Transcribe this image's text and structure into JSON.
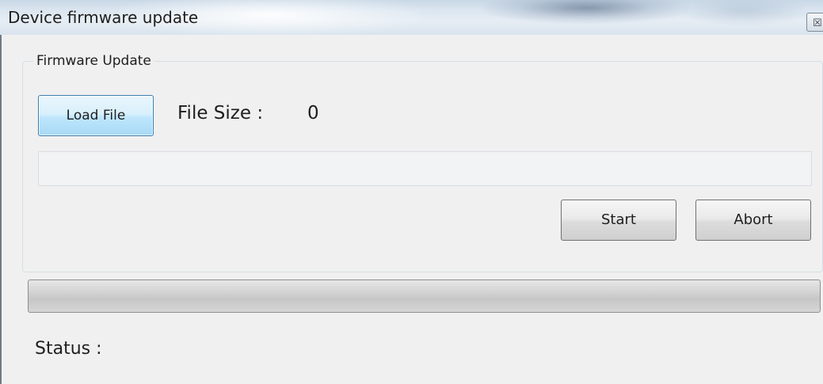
{
  "window": {
    "title": "Device firmware update",
    "close_glyph": "☒",
    "close_icon": "close-icon"
  },
  "firmware_group": {
    "legend": "Firmware Update",
    "load_button_label": "Load File",
    "file_size_label": "File Size :",
    "file_size_value": "0",
    "file_path_value": "",
    "start_button_label": "Start",
    "abort_button_label": "Abort"
  },
  "progress": {
    "percent": 0
  },
  "status": {
    "label": "Status :",
    "value": ""
  },
  "colors": {
    "window_bg": "#f0f0f0",
    "button_focus_border": "#3c7fb1",
    "progress_fill": "#37c32a"
  }
}
